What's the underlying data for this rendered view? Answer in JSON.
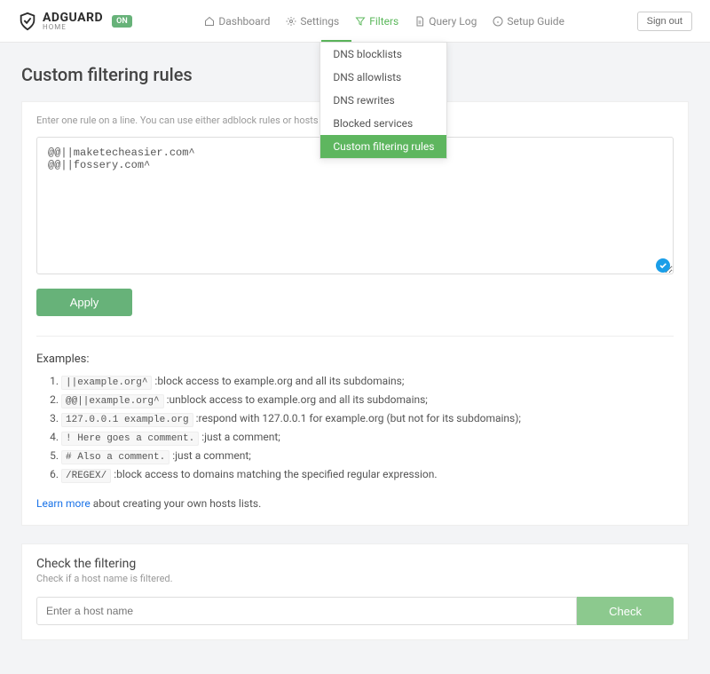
{
  "header": {
    "brand": "ADGUARD",
    "brand_sub": "HOME",
    "status_badge": "ON",
    "signout": "Sign out",
    "nav": [
      {
        "label": "Dashboard"
      },
      {
        "label": "Settings"
      },
      {
        "label": "Filters"
      },
      {
        "label": "Query Log"
      },
      {
        "label": "Setup Guide"
      }
    ],
    "dropdown": [
      "DNS blocklists",
      "DNS allowlists",
      "DNS rewrites",
      "Blocked services",
      "Custom filtering rules"
    ]
  },
  "page": {
    "title": "Custom filtering rules",
    "hint": "Enter one rule on a line. You can use either adblock rules or hosts files syntax.",
    "rules_text": "@@||maketecheasier.com^\n@@||fossery.com^",
    "apply": "Apply",
    "examples_title": "Examples:",
    "examples": [
      {
        "code": "||example.org^",
        "desc": ":block access to example.org and all its subdomains;"
      },
      {
        "code": "@@||example.org^",
        "desc": ":unblock access to example.org and all its subdomains;"
      },
      {
        "code": "127.0.0.1 example.org",
        "desc": ":respond with 127.0.0.1 for example.org (but not for its subdomains);"
      },
      {
        "code": "! Here goes a comment.",
        "desc": ":just a comment;"
      },
      {
        "code": "# Also a comment.",
        "desc": ":just a comment;"
      },
      {
        "code": "/REGEX/",
        "desc": ":block access to domains matching the specified regular expression."
      }
    ],
    "learn_more": "Learn more",
    "learn_more_suffix": " about creating your own hosts lists."
  },
  "check": {
    "title": "Check the filtering",
    "sub": "Check if a host name is filtered.",
    "placeholder": "Enter a host name",
    "button": "Check"
  }
}
